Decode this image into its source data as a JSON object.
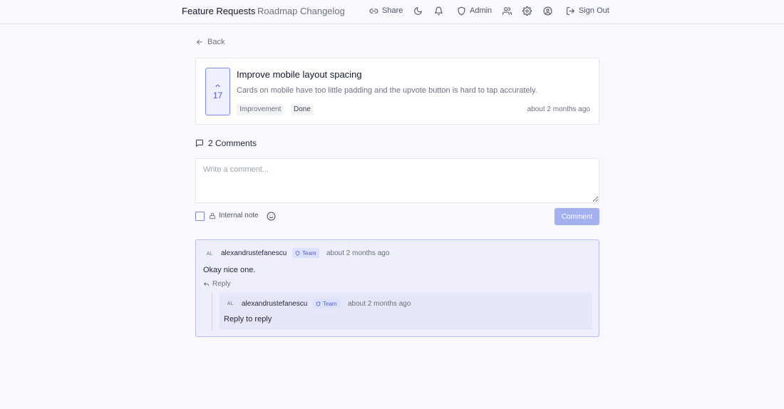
{
  "nav": {
    "brand": "Feature Requests",
    "roadmap": "Roadmap",
    "changelog": "Changelog",
    "share": "Share",
    "admin": "Admin",
    "sign_out": "Sign Out"
  },
  "back_label": "Back",
  "post": {
    "votes": "17",
    "title": "Improve mobile layout spacing",
    "description": "Cards on mobile have too little padding and the upvote button is hard to tap accurately.",
    "tags": [
      "Improvement",
      "Done"
    ],
    "time": "about 2 months ago"
  },
  "comments": {
    "header": "2 Comments",
    "placeholder": "Write a comment...",
    "internal_note": "Internal note",
    "submit": "Comment"
  },
  "thread": {
    "comment": {
      "initials": "AL",
      "author": "alexandrustefanescu",
      "badge": "Team",
      "time": "about 2 months ago",
      "body": "Okay nice one.",
      "reply_label": "Reply"
    },
    "reply": {
      "initials": "AL",
      "author": "alexandrustefanescu",
      "badge": "Team",
      "time": "about 2 months ago",
      "body": "Reply to reply"
    }
  },
  "colors": {
    "accent": "#4f5fd6",
    "accent_light": "#eef0ff",
    "button_disabled": "#a5b0ee",
    "page_bg": "#f9f8fc"
  }
}
